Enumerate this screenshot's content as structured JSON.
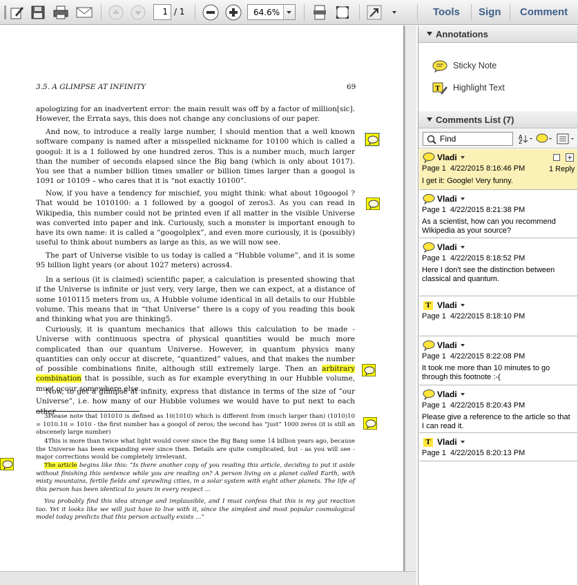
{
  "toolbar": {
    "page_current": "1",
    "page_total": "/ 1",
    "zoom": "64.6%",
    "tools_label": "Tools",
    "sign_label": "Sign",
    "comment_label": "Comment"
  },
  "document": {
    "header_left": "3.5.  A GLIMPSE AT INFINITY",
    "header_right": "69",
    "p1": "apologizing for an inadvertent error: the main result was off by a factor of million[sic]. However, the Errata says, this does not change any conclusions of our paper.",
    "p2": "And now, to introduce a really large number, I should mention that a well known software company is named after a misspelled nickname for 10100 which is called a googol: it is a 1 followed by one hundred zeros. This is a number much, much larger than the number of seconds elapsed since the Big bang (which is only about 1017). You see that a number billion times smaller or billion times larger than a googol is 1091 or 10109 – who cares that it is “not exactly 10100”.",
    "p3": "Now, if you have a tendency for mischief, you might think: what about 10googol ? That would be 1010100: a 1 followed by a googol of zeros3. As you can read in Wikipedia, this number could not be printed even if all matter in the visible Universe was converted into paper and ink. Curiously, such a monster is important enough to have its own name: it is called a “googolplex”, and even more curiously, it is (possibly) useful to think about numbers as large as this, as we will now see.",
    "p4": "The part of Universe visible to us today is called a “Hubble volume”, and it is some 95 billion light years (or about 1027 meters) across4.",
    "p5": "In a serious (it is claimed) scientific paper, a calculation is presented showing that if the Universe is infinite or just very, very large, then we can expect, at a distance of some 1010115 meters from us, A Hubble volume identical in all details to our Hubble volume. This means that in “that Universe” there is a copy of you reading this book and thinking what you are thinking5.",
    "p6_a": "Curiously, it is quantum mechanics that allows this calculation to be made - Universe with continuous spectra of physical quantities would be much more complicated than our quantum Universe. However, in quantum physics many quantities can only occur at discrete, “quantized” values, and that makes the number of possible combinations finite, although still extremely large. Then an ",
    "p6_hl": "arbitrary combination",
    "p6_b": " that is possible, such as for example everything in our Hubble volume, must occur somewhere else.",
    "p7": "Now, to get a glimpse at infinity, express that distance in terms of the size of ”our Universe”, i.e. how many of our Hubble volumes we would have to put next to each other",
    "fn3": "3Please note that 101010 is defined as 10(1010) which is different from (much larger than) (1010)10 = 1010.10 = 1010 - the first number has a googol of zeros; the second has “just” 1000 zeros (it is still an obscenely large number)",
    "fn4": "4This is more than twice what light would cover since the Big Bang some 14 billion years ago, because the Universe has been expanding ever since then. Details are quite complicated, but - as you will see - major corrections would be completely irrelevant.",
    "fn5_hl": "The article",
    "fn5_a": " begins like this: “Is there another copy of you reading this article, deciding to put it aside without finishing this sentence while you are reading on? A person living on a planet called Earth, with misty mountains, fertile fields and sprawling cities, in a solar system with eight other planets. The life of this person has been identical to yours in every respect ...",
    "fn5_b": "You probably find this idea strange and implausible, and I must confess that this is my gut reaction too. Yet it looks like we will just have to live with it, since the simplest and most popular cosmological model today predicts that this person actually exists ...”"
  },
  "sidebar": {
    "annotations_title": "Annotations",
    "sticky_note": "Sticky Note",
    "highlight_text": "Highlight Text",
    "comments_title": "Comments List (7)",
    "find_placeholder": "Find",
    "comments": [
      {
        "author": "Vladi",
        "page": "Page 1",
        "date": "4/22/2015 8:16:46 PM",
        "text": "I get it: Google! Very funny.",
        "reply": "1 Reply",
        "kind": "note"
      },
      {
        "author": "Vladi",
        "page": "Page 1",
        "date": "4/22/2015 8:21:38 PM",
        "text": "As a scientist, how can you recommend Wikipedia as your source?",
        "kind": "note"
      },
      {
        "author": "Vladi",
        "page": "Page 1",
        "date": "4/22/2015 8:18:52 PM",
        "text": "Here I don't see the distinction between classical and quantum.",
        "kind": "note"
      },
      {
        "author": "Vladi",
        "page": "Page 1",
        "date": "4/22/2015 8:18:10 PM",
        "text": "",
        "kind": "highlight"
      },
      {
        "author": "Vladi",
        "page": "Page 1",
        "date": "4/22/2015 8:22:08 PM",
        "text": "It took me more than 10 minutes to go through this footnote :-(",
        "kind": "note"
      },
      {
        "author": "Vladi",
        "page": "Page 1",
        "date": "4/22/2015 8:20:43 PM",
        "text": "Please give a reference to the article so that I can read it.",
        "kind": "note"
      },
      {
        "author": "Vladi",
        "page": "Page 1",
        "date": "4/22/2015 8:20:13 PM",
        "text": "",
        "kind": "highlight"
      }
    ]
  },
  "colors": {
    "highlight": "#ffff33",
    "note_yellow": "#ffff00",
    "selected_comment": "#fbf1b6",
    "link_blue": "#3e5f8a"
  }
}
